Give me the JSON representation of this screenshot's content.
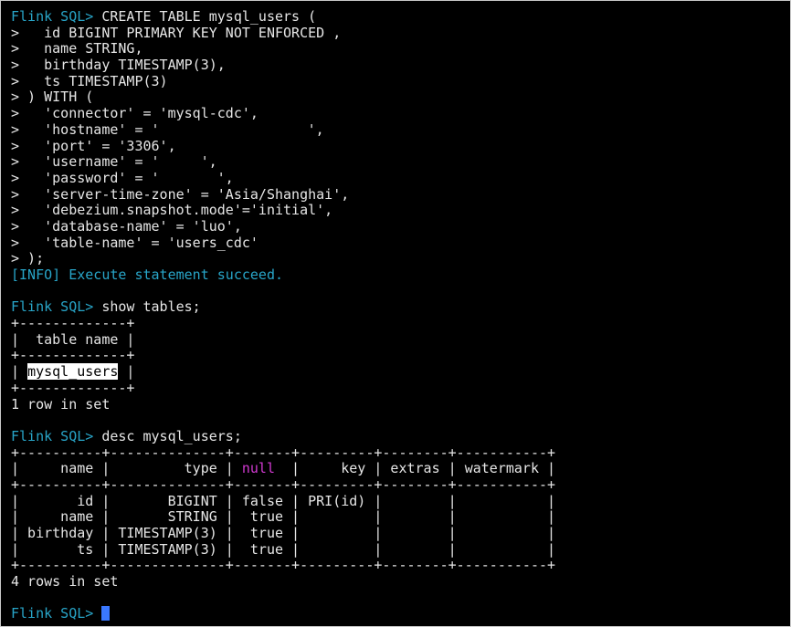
{
  "prompt": "Flink SQL>",
  "lines": [
    [
      {
        "t": "Flink SQL>",
        "c": "prompt"
      },
      {
        "t": " CREATE TABLE mysql_users ("
      }
    ],
    [
      {
        "t": ">   id BIGINT PRIMARY KEY NOT ENFORCED ,"
      }
    ],
    [
      {
        "t": ">   name STRING,"
      }
    ],
    [
      {
        "t": ">   birthday TIMESTAMP(3),"
      }
    ],
    [
      {
        "t": ">   ts TIMESTAMP(3)"
      }
    ],
    [
      {
        "t": "> ) WITH ("
      }
    ],
    [
      {
        "t": ">   'connector' = 'mysql-cdc',"
      }
    ],
    [
      {
        "t": ">   'hostname' = '"
      },
      {
        "redact": 18
      },
      {
        "t": "',"
      }
    ],
    [
      {
        "t": ">   'port' = '3306',"
      }
    ],
    [
      {
        "t": ">   'username' = '"
      },
      {
        "redact": 5
      },
      {
        "t": "',"
      }
    ],
    [
      {
        "t": ">   'password' = '"
      },
      {
        "redact": 7
      },
      {
        "t": "',"
      }
    ],
    [
      {
        "t": ">   'server-time-zone' = 'Asia/Shanghai',"
      }
    ],
    [
      {
        "t": ">   'debezium.snapshot.mode'='initial',"
      }
    ],
    [
      {
        "t": ">   'database-name' = 'luo',"
      }
    ],
    [
      {
        "t": ">   'table-name' = 'users_cdc'"
      }
    ],
    [
      {
        "t": "> );"
      }
    ],
    [
      {
        "t": "[INFO] Execute statement succeed.",
        "c": "info"
      }
    ],
    [],
    [
      {
        "t": "Flink SQL>",
        "c": "prompt"
      },
      {
        "t": " show tables;"
      }
    ],
    [
      {
        "t": "+-------------+"
      }
    ],
    [
      {
        "t": "|  table name |"
      }
    ],
    [
      {
        "t": "+-------------+"
      }
    ],
    [
      {
        "t": "| "
      },
      {
        "t": "mysql_users",
        "c": "hl"
      },
      {
        "t": " |"
      }
    ],
    [
      {
        "t": "+-------------+"
      }
    ],
    [
      {
        "t": "1 row in set"
      }
    ],
    [],
    [
      {
        "t": "Flink SQL>",
        "c": "prompt"
      },
      {
        "t": " desc mysql_users;"
      }
    ],
    [
      {
        "t": "+----------+--------------+-------+---------+--------+-----------+"
      }
    ],
    [
      {
        "t": "|     name |         type | "
      },
      {
        "t": "null",
        "c": "magenta"
      },
      {
        "t": "  |     key | extras | watermark |"
      }
    ],
    [
      {
        "t": "+----------+--------------+-------+---------+--------+-----------+"
      }
    ],
    [
      {
        "t": "|       id |       BIGINT | false | PRI(id) |        |           |"
      }
    ],
    [
      {
        "t": "|     name |       STRING |  true |         |        |           |"
      }
    ],
    [
      {
        "t": "| birthday | TIMESTAMP(3) |  true |         |        |           |"
      }
    ],
    [
      {
        "t": "|       ts | TIMESTAMP(3) |  true |         |        |           |"
      }
    ],
    [
      {
        "t": "+----------+--------------+-------+---------+--------+-----------+"
      }
    ],
    [
      {
        "t": "4 rows in set"
      }
    ],
    [],
    [
      {
        "t": "Flink SQL>",
        "c": "prompt"
      },
      {
        "t": " "
      },
      {
        "cursor": true
      }
    ]
  ]
}
